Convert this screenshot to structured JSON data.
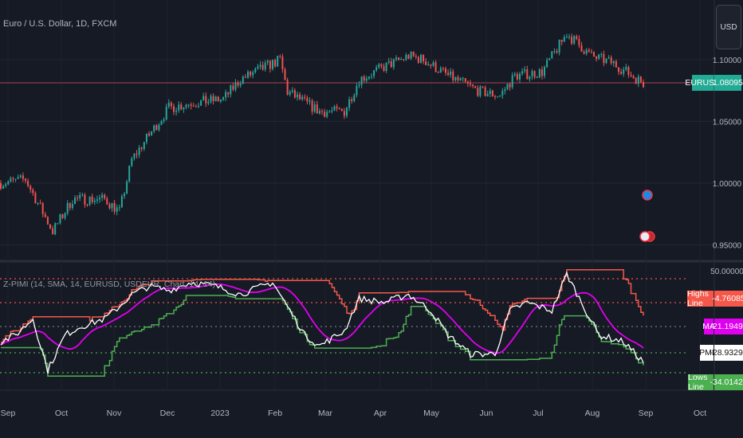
{
  "header": {
    "symbol_title": "Euro / U.S. Dollar, 1D, FXCM",
    "currency_button": "USD"
  },
  "indicator": {
    "title": "Z-PIMI (14, SMA, 14, EURUSD, USDEUR, Chart, 14, 14)"
  },
  "colors": {
    "up": "#26a69a",
    "down": "#ef5350",
    "highs": "#f5584a",
    "lows": "#4caf50",
    "ma": "#e000f0",
    "pmi": "#ffffff",
    "price_line": "#8c3a46",
    "background": "#161a25"
  },
  "chart_data": [
    {
      "type": "candlestick",
      "title": "Euro / U.S. Dollar, 1D, FXCM",
      "price_axis_ticks": [
        "1.10000",
        "1.05000",
        "1.00000",
        "0.95000"
      ],
      "ylim": [
        0.935,
        1.145
      ],
      "last_price": {
        "symbol": "EURUSD",
        "value": "1.08095"
      },
      "close_path_day_price": [
        [
          0,
          1.0
        ],
        [
          10,
          1.003
        ],
        [
          21,
          0.961
        ],
        [
          29,
          0.987
        ],
        [
          42,
          0.987
        ],
        [
          48,
          0.977
        ],
        [
          53,
          1.019
        ],
        [
          60,
          1.039
        ],
        [
          68,
          1.061
        ],
        [
          77,
          1.065
        ],
        [
          90,
          1.068
        ],
        [
          97,
          1.084
        ],
        [
          113,
          1.1
        ],
        [
          116,
          1.074
        ],
        [
          129,
          1.058
        ],
        [
          139,
          1.058
        ],
        [
          145,
          1.084
        ],
        [
          155,
          1.094
        ],
        [
          165,
          1.103
        ],
        [
          171,
          1.1
        ],
        [
          181,
          1.087
        ],
        [
          194,
          1.074
        ],
        [
          202,
          1.071
        ],
        [
          208,
          1.087
        ],
        [
          219,
          1.09
        ],
        [
          229,
          1.121
        ],
        [
          239,
          1.103
        ],
        [
          248,
          1.097
        ],
        [
          260,
          1.081
        ]
      ],
      "x_axis_ticks": [
        "Sep",
        "Oct",
        "Nov",
        "Dec",
        "2023",
        "Feb",
        "Mar",
        "Apr",
        "May",
        "Jun",
        "Jul",
        "Aug",
        "Sep",
        "Oct"
      ],
      "events": [
        "EU economic event",
        "US economic event"
      ]
    },
    {
      "type": "line",
      "title": "Z-PIMI (14, SMA, 14, EURUSD, USDEUR, Chart, 14, 14)",
      "axis_label": "50.00000",
      "pmi_path_day_value": [
        [
          0,
          -16
        ],
        [
          6,
          -11
        ],
        [
          13,
          1
        ],
        [
          19,
          -37
        ],
        [
          26,
          -11
        ],
        [
          32,
          -5
        ],
        [
          42,
          1
        ],
        [
          48,
          10
        ],
        [
          53,
          19
        ],
        [
          60,
          25
        ],
        [
          68,
          22
        ],
        [
          77,
          28
        ],
        [
          87,
          25
        ],
        [
          97,
          19
        ],
        [
          110,
          28
        ],
        [
          116,
          10
        ],
        [
          123,
          -11
        ],
        [
          129,
          -19
        ],
        [
          139,
          -8
        ],
        [
          145,
          16
        ],
        [
          155,
          13
        ],
        [
          165,
          19
        ],
        [
          174,
          7
        ],
        [
          181,
          -11
        ],
        [
          190,
          -25
        ],
        [
          200,
          -25
        ],
        [
          206,
          7
        ],
        [
          213,
          13
        ],
        [
          223,
          7
        ],
        [
          229,
          34
        ],
        [
          235,
          13
        ],
        [
          242,
          -11
        ],
        [
          252,
          -16
        ],
        [
          260,
          -31
        ]
      ],
      "series_last": [
        {
          "name": "Highs Line",
          "value": "-4.76085"
        },
        {
          "name": "MA",
          "value": "-21.19491"
        },
        {
          "name": "PMI",
          "value": "-28.93292"
        },
        {
          "name": "Lows Line",
          "value": "-34.01423"
        }
      ]
    }
  ]
}
